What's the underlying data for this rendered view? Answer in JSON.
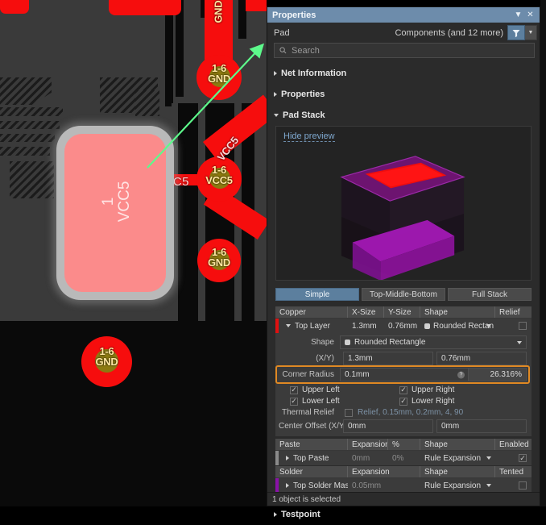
{
  "canvas": {
    "selected_pad": {
      "designator": "1",
      "net": "VCC5"
    },
    "track_label": "VCC5",
    "vias": [
      {
        "id": "via-gnd-top",
        "line1": "1-6",
        "line2": "GND"
      },
      {
        "id": "via-vcc5",
        "line1": "1-6",
        "line2": "VCC5"
      },
      {
        "id": "via-gnd-mid",
        "line1": "1-6",
        "line2": "GND"
      },
      {
        "id": "via-gnd-bot",
        "line1": "1-6",
        "line2": "GND"
      }
    ],
    "net_labels": [
      {
        "id": "gnd-vertical",
        "text": "GND"
      },
      {
        "id": "vcc5-diagonal",
        "text": "VCC5"
      }
    ]
  },
  "panel": {
    "title": "Properties",
    "collapse_icon": "chevron-down-icon",
    "close_icon": "close-icon",
    "object_type": "Pad",
    "scope": "Components (and 12 more)",
    "filter_icon": "funnel-icon",
    "filter_dropdown_icon": "chevron-down-icon",
    "search": {
      "icon": "search-icon",
      "placeholder": "Search",
      "value": ""
    },
    "sections": [
      {
        "name": "Net Information",
        "expanded": false
      },
      {
        "name": "Properties",
        "expanded": false
      },
      {
        "name": "Pad Stack",
        "expanded": true
      }
    ],
    "preview": {
      "toggle_label": "Hide preview"
    },
    "tabs": [
      {
        "label": "Simple",
        "selected": true
      },
      {
        "label": "Top-Middle-Bottom",
        "selected": false
      },
      {
        "label": "Full Stack",
        "selected": false
      }
    ],
    "copper": {
      "headers": [
        "Copper",
        "X-Size",
        "Y-Size",
        "Shape",
        "Relief"
      ],
      "row": {
        "layer": "Top Layer",
        "x_size": "1.3mm",
        "y_size": "0.76mm",
        "shape": "Rounded Rectan",
        "relief_checked": false,
        "color": "#e01010"
      },
      "shape_label": "Shape",
      "shape_value": "Rounded Rectangle",
      "xy_label": "(X/Y)",
      "x_value": "1.3mm",
      "y_value": "0.76mm",
      "corner_radius_label": "Corner Radius",
      "corner_radius_value": "0.1mm",
      "corner_radius_percent": "26.316%",
      "corner_help_icon": "help-icon",
      "corners": [
        {
          "label": "Upper Left",
          "checked": true
        },
        {
          "label": "Upper Right",
          "checked": true
        },
        {
          "label": "Lower Left",
          "checked": true
        },
        {
          "label": "Lower Right",
          "checked": true
        }
      ],
      "thermal_label": "Thermal Relief",
      "thermal_checked": false,
      "thermal_value": "Relief, 0.15mm, 0.2mm, 4, 90",
      "center_offset_label": "Center Offset (X/Y)",
      "center_offset_x": "0mm",
      "center_offset_y": "0mm"
    },
    "paste": {
      "headers": [
        "Paste",
        "Expansion",
        "%",
        "Shape",
        "Enabled"
      ],
      "row": {
        "layer": "Top Paste",
        "expansion": "0mm",
        "percent": "0%",
        "shape": "Rule Expansion",
        "enabled": true,
        "color": "#8a8a8a"
      }
    },
    "solder": {
      "headers": [
        "Solder",
        "Expansion",
        "Shape",
        "Tented"
      ],
      "row": {
        "layer": "Top Solder Mask",
        "expansion": "0.05mm",
        "shape": "Rule Expansion",
        "tented": false,
        "color": "#8a11a8"
      }
    },
    "testpoint_section": {
      "name": "Testpoint",
      "expanded": false
    },
    "status": "1 object is selected",
    "accent_highlight": "#e08923"
  }
}
